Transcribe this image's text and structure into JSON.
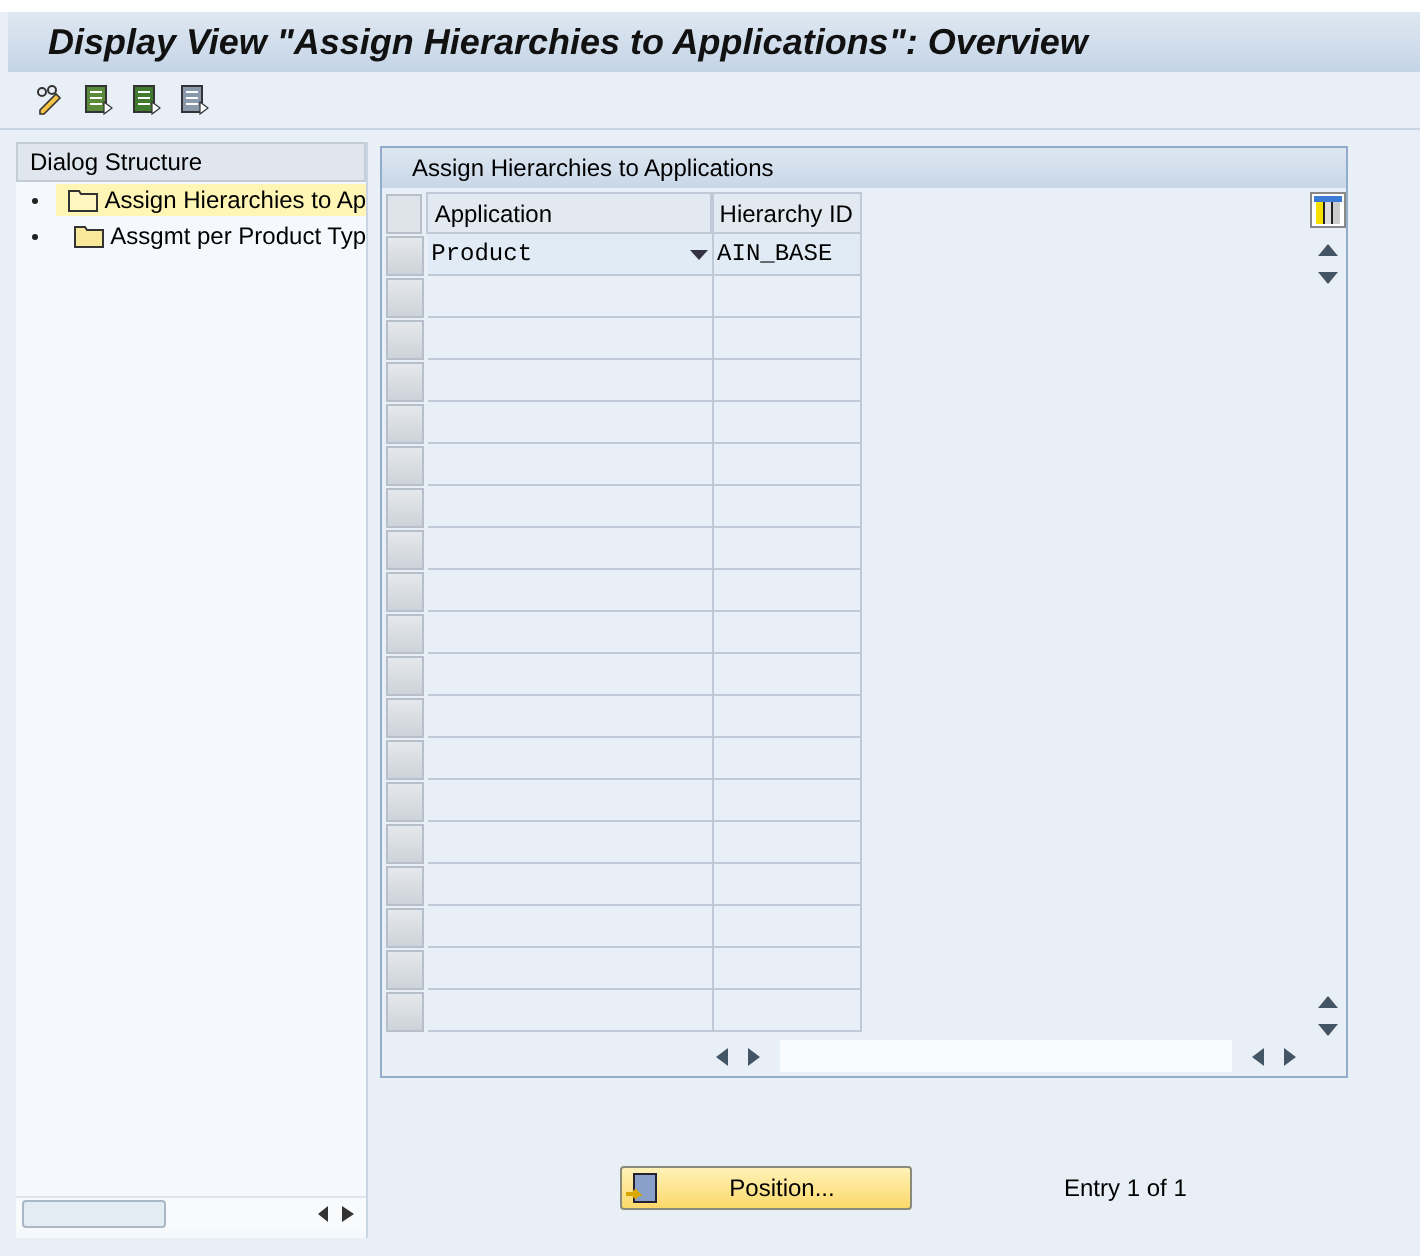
{
  "window": {
    "title": "Display View \"Assign Hierarchies to Applications\": Overview"
  },
  "dialog_structure": {
    "title": "Dialog Structure",
    "items": [
      {
        "label": "Assign Hierarchies to Ap",
        "selected": true
      },
      {
        "label": "Assgmt per Product Typ",
        "selected": false
      }
    ]
  },
  "table": {
    "title": "Assign Hierarchies to Applications",
    "columns": [
      "Application",
      "Hierarchy ID"
    ],
    "rows": [
      {
        "application": "Product",
        "hierarchy_id": "AIN_BASE"
      }
    ]
  },
  "position_button": "Position...",
  "entry_info": "Entry 1 of 1"
}
